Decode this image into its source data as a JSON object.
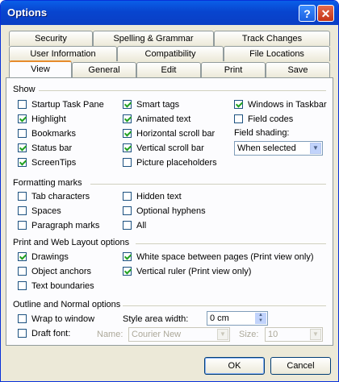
{
  "window": {
    "title": "Options",
    "help_label": "?",
    "close_label": "✕"
  },
  "tabs": {
    "row1": [
      "Security",
      "Spelling & Grammar",
      "Track Changes"
    ],
    "row2": [
      "User Information",
      "Compatibility",
      "File Locations"
    ],
    "row3": [
      "View",
      "General",
      "Edit",
      "Print",
      "Save"
    ],
    "active": "View"
  },
  "show": {
    "label": "Show",
    "col1": [
      {
        "label": "Startup Task Pane",
        "checked": false
      },
      {
        "label": "Highlight",
        "checked": true
      },
      {
        "label": "Bookmarks",
        "checked": false
      },
      {
        "label": "Status bar",
        "checked": true
      },
      {
        "label": "ScreenTips",
        "checked": true
      }
    ],
    "col2": [
      {
        "label": "Smart tags",
        "checked": true
      },
      {
        "label": "Animated text",
        "checked": true
      },
      {
        "label": "Horizontal scroll bar",
        "checked": true
      },
      {
        "label": "Vertical scroll bar",
        "checked": true
      },
      {
        "label": "Picture placeholders",
        "checked": false
      }
    ],
    "col3": [
      {
        "label": "Windows in Taskbar",
        "checked": true
      },
      {
        "label": "Field codes",
        "checked": false
      }
    ],
    "field_shading_label": "Field shading:",
    "field_shading_value": "When selected"
  },
  "formatting": {
    "label": "Formatting marks",
    "col1": [
      {
        "label": "Tab characters",
        "checked": false
      },
      {
        "label": "Spaces",
        "checked": false
      },
      {
        "label": "Paragraph marks",
        "checked": false
      }
    ],
    "col2": [
      {
        "label": "Hidden text",
        "checked": false
      },
      {
        "label": "Optional hyphens",
        "checked": false
      },
      {
        "label": "All",
        "checked": false
      }
    ]
  },
  "print_web": {
    "label": "Print and Web Layout options",
    "col1": [
      {
        "label": "Drawings",
        "checked": true
      },
      {
        "label": "Object anchors",
        "checked": false
      },
      {
        "label": "Text boundaries",
        "checked": false
      }
    ],
    "col2": [
      {
        "label": "White space between pages (Print view only)",
        "checked": true
      },
      {
        "label": "Vertical ruler (Print view only)",
        "checked": true
      }
    ]
  },
  "outline": {
    "label": "Outline and Normal options",
    "wrap_label": "Wrap to window",
    "draft_label": "Draft font:",
    "style_area_label": "Style area width:",
    "style_area_value": "0 cm",
    "name_label": "Name:",
    "name_value": "Courier New",
    "size_label": "Size:",
    "size_value": "10"
  },
  "buttons": {
    "ok": "OK",
    "cancel": "Cancel"
  }
}
